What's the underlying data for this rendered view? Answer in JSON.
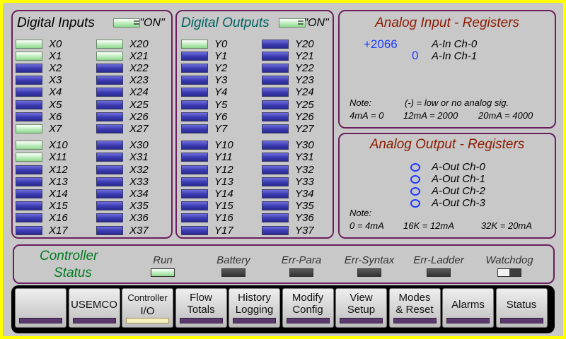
{
  "colors": {
    "background": "#ffff00",
    "panel_border": "#6b1f5e",
    "led_off": "#3a3ab0",
    "led_on": "#c8f0c8",
    "title_digital_inputs": "#000000",
    "title_digital_outputs": "#006060",
    "title_analog": "#8b1a00",
    "title_controller": "#007a20",
    "register_value": "#1b3cff"
  },
  "digital_inputs": {
    "title": "Digital Inputs",
    "legend": "=\"ON\"",
    "col1": [
      {
        "label": "X0",
        "on": true
      },
      {
        "label": "X1",
        "on": true
      },
      {
        "label": "X2",
        "on": false
      },
      {
        "label": "X3",
        "on": false
      },
      {
        "label": "X4",
        "on": false
      },
      {
        "label": "X5",
        "on": false
      },
      {
        "label": "X6",
        "on": false
      },
      {
        "label": "X7",
        "on": true
      },
      {
        "label": "X10",
        "on": true
      },
      {
        "label": "X11",
        "on": true
      },
      {
        "label": "X12",
        "on": false
      },
      {
        "label": "X13",
        "on": false
      },
      {
        "label": "X14",
        "on": false
      },
      {
        "label": "X15",
        "on": false
      },
      {
        "label": "X16",
        "on": false
      },
      {
        "label": "X17",
        "on": false
      }
    ],
    "col2": [
      {
        "label": "X20",
        "on": true
      },
      {
        "label": "X21",
        "on": true
      },
      {
        "label": "X22",
        "on": false
      },
      {
        "label": "X23",
        "on": false
      },
      {
        "label": "X24",
        "on": false
      },
      {
        "label": "X25",
        "on": false
      },
      {
        "label": "X26",
        "on": false
      },
      {
        "label": "X27",
        "on": false
      },
      {
        "label": "X30",
        "on": false
      },
      {
        "label": "X31",
        "on": false
      },
      {
        "label": "X32",
        "on": false
      },
      {
        "label": "X33",
        "on": false
      },
      {
        "label": "X34",
        "on": false
      },
      {
        "label": "X35",
        "on": false
      },
      {
        "label": "X36",
        "on": false
      },
      {
        "label": "X37",
        "on": false
      }
    ]
  },
  "digital_outputs": {
    "title": "Digital Outputs",
    "legend": "=\"ON\"",
    "col1": [
      {
        "label": "Y0",
        "on": true
      },
      {
        "label": "Y1",
        "on": false
      },
      {
        "label": "Y2",
        "on": false
      },
      {
        "label": "Y3",
        "on": false
      },
      {
        "label": "Y4",
        "on": false
      },
      {
        "label": "Y5",
        "on": false
      },
      {
        "label": "Y6",
        "on": false
      },
      {
        "label": "Y7",
        "on": false
      },
      {
        "label": "Y10",
        "on": false
      },
      {
        "label": "Y11",
        "on": false
      },
      {
        "label": "Y12",
        "on": false
      },
      {
        "label": "Y13",
        "on": false
      },
      {
        "label": "Y14",
        "on": false
      },
      {
        "label": "Y15",
        "on": false
      },
      {
        "label": "Y16",
        "on": false
      },
      {
        "label": "Y17",
        "on": false
      }
    ],
    "col2": [
      {
        "label": "Y20",
        "on": false
      },
      {
        "label": "Y21",
        "on": false
      },
      {
        "label": "Y22",
        "on": false
      },
      {
        "label": "Y23",
        "on": false
      },
      {
        "label": "Y24",
        "on": false
      },
      {
        "label": "Y25",
        "on": false
      },
      {
        "label": "Y26",
        "on": false
      },
      {
        "label": "Y27",
        "on": false
      },
      {
        "label": "Y30",
        "on": false
      },
      {
        "label": "Y31",
        "on": false
      },
      {
        "label": "Y32",
        "on": false
      },
      {
        "label": "Y33",
        "on": false
      },
      {
        "label": "Y34",
        "on": false
      },
      {
        "label": "Y35",
        "on": false
      },
      {
        "label": "Y36",
        "on": false
      },
      {
        "label": "Y37",
        "on": false
      }
    ]
  },
  "analog_input": {
    "title": "Analog Input - Registers",
    "ch0_value": "+2066",
    "ch0_label": "A-In Ch-0",
    "ch1_value": "0",
    "ch1_label": "A-In Ch-1",
    "note_label": "Note:",
    "note_text": "(-) = low or no analog sig.",
    "scale_1": "4mA = 0",
    "scale_2": "12mA = 2000",
    "scale_3": "20mA = 4000"
  },
  "analog_output": {
    "title": "Analog Output - Registers",
    "channels": [
      "A-Out Ch-0",
      "A-Out Ch-1",
      "A-Out Ch-2",
      "A-Out Ch-3"
    ],
    "note_label": "Note:",
    "scale_1": "0 = 4mA",
    "scale_2": "16K = 12mA",
    "scale_3": "32K = 20mA"
  },
  "controller_status": {
    "title_line1": "Controller",
    "title_line2": "Status",
    "items": [
      {
        "label": "Run",
        "state": "on"
      },
      {
        "label": "Battery",
        "state": "off"
      },
      {
        "label": "Err-Para",
        "state": "off"
      },
      {
        "label": "Err-Syntax",
        "state": "off"
      },
      {
        "label": "Err-Ladder",
        "state": "off"
      },
      {
        "label": "Watchdog",
        "state": "half"
      }
    ]
  },
  "nav": {
    "buttons": [
      {
        "line1": "",
        "line2": "",
        "active": false
      },
      {
        "line1": "USEMCO",
        "line2": "",
        "active": false
      },
      {
        "line1": "Controller",
        "line2": "I/O",
        "active": true
      },
      {
        "line1": "Flow",
        "line2": "Totals",
        "active": false
      },
      {
        "line1": "History",
        "line2": "Logging",
        "active": false
      },
      {
        "line1": "Modify",
        "line2": "Config",
        "active": false
      },
      {
        "line1": "View",
        "line2": "Setup",
        "active": false
      },
      {
        "line1": "Modes",
        "line2": "& Reset",
        "active": false
      },
      {
        "line1": "Alarms",
        "line2": "",
        "active": false
      },
      {
        "line1": "Status",
        "line2": "",
        "active": false
      }
    ]
  }
}
